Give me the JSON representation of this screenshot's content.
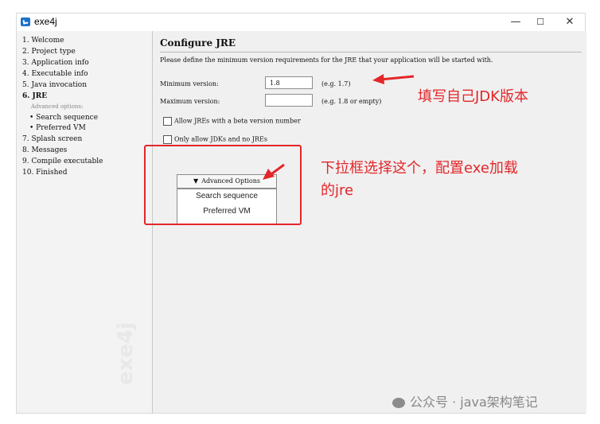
{
  "window": {
    "title": "exe4j",
    "controls": {
      "minimize": "—",
      "maximize": "☐",
      "close": "✕"
    }
  },
  "sidebar": {
    "steps": [
      {
        "label": "1. Welcome"
      },
      {
        "label": "2. Project type"
      },
      {
        "label": "3. Application info"
      },
      {
        "label": "4. Executable info"
      },
      {
        "label": "5. Java invocation"
      },
      {
        "label": "6. JRE"
      },
      {
        "label": "Advanced options:"
      },
      {
        "label": "• Search sequence"
      },
      {
        "label": "• Preferred VM"
      },
      {
        "label": "7. Splash screen"
      },
      {
        "label": "8. Messages"
      },
      {
        "label": "9. Compile executable"
      },
      {
        "label": "10. Finished"
      }
    ],
    "logo_text": "exe4j"
  },
  "main": {
    "title": "Configure JRE",
    "description": "Please define the minimum version requirements for the JRE that your application will be started with.",
    "min_version": {
      "label": "Minimum version:",
      "value": "1.8",
      "hint": "(e.g. 1.7)"
    },
    "max_version": {
      "label": "Maximum version:",
      "value": "",
      "hint": "(e.g. 1.8 or empty)"
    },
    "checkboxes": [
      {
        "label": "Allow JREs with a beta version number",
        "checked": false
      },
      {
        "label": "Only allow JDKs and no JREs",
        "checked": false
      }
    ],
    "advanced_button": {
      "label": "Advanced Options"
    },
    "advanced_menu": [
      "Search sequence",
      "Preferred VM"
    ]
  },
  "annotations": {
    "jdk_note": "填写自己JDK版本",
    "dropdown_note_line1": "下拉框选择这个，配置exe加载",
    "dropdown_note_line2": "的jre"
  },
  "footer": {
    "watermark": "公众号 · java架构笔记"
  },
  "colors": {
    "annotation_red": "#e3262a",
    "window_bg": "#f0f0f0"
  }
}
